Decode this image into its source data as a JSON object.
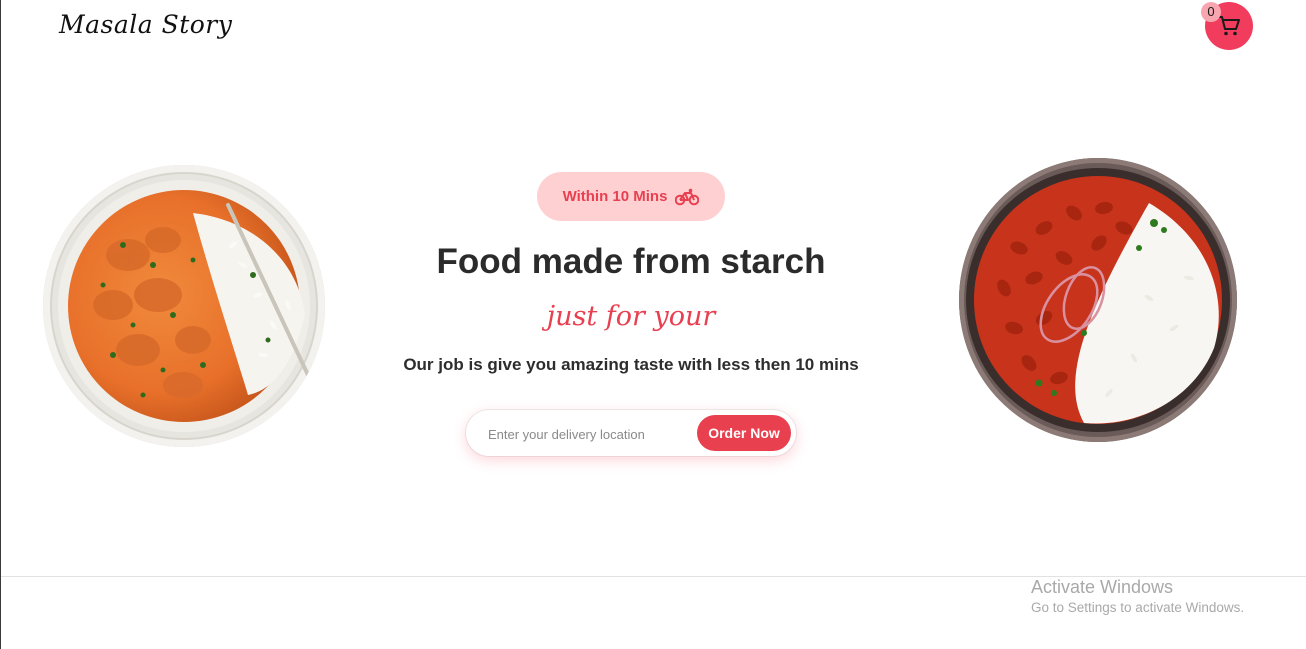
{
  "header": {
    "brand": "Masala Story",
    "cart": {
      "count": "0",
      "icon": "cart-icon",
      "color": "#f23c5e"
    }
  },
  "hero": {
    "badge_text": "Within 10 Mins",
    "badge_icon": "bicycle-icon",
    "headline": "Food made from starch",
    "tagline": "just for your",
    "subline": "Our job is give you amazing taste with less then 10 mins",
    "search": {
      "placeholder": "Enter your delivery location",
      "value": ""
    },
    "order_button": "Order Now",
    "accent_color": "#e84050"
  },
  "images": {
    "left_dish": "butter-chicken-rice-image",
    "right_dish": "rajma-rice-image"
  },
  "watermark": {
    "title": "Activate Windows",
    "subtitle": "Go to Settings to activate Windows."
  }
}
